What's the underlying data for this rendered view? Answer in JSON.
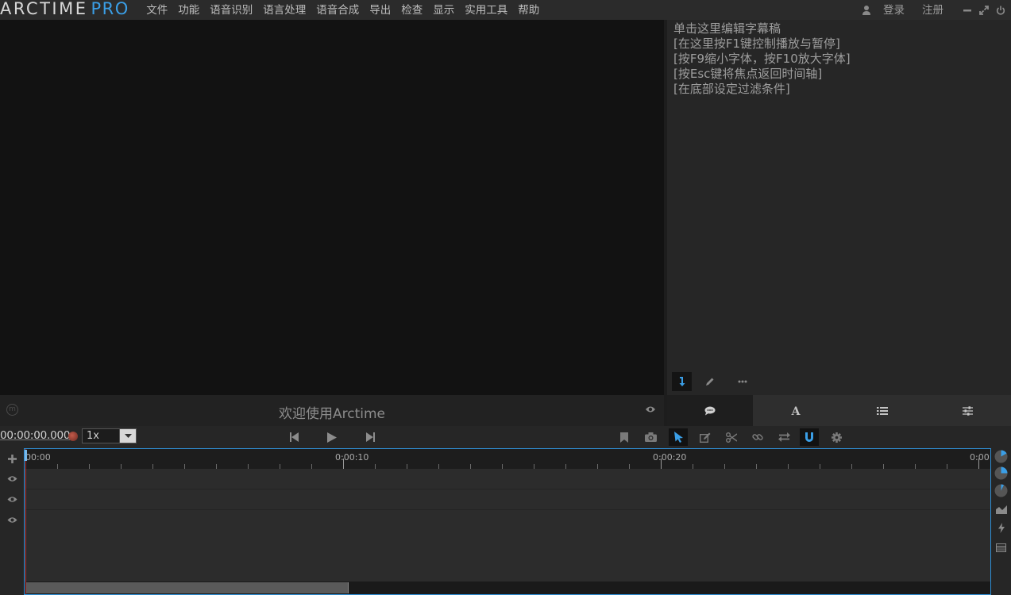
{
  "app": {
    "logo_main": "ARCTIME",
    "logo_pro": "PRO"
  },
  "menu": [
    "文件",
    "功能",
    "语音识别",
    "语言处理",
    "语音合成",
    "导出",
    "检查",
    "显示",
    "实用工具",
    "帮助"
  ],
  "auth": {
    "login": "登录",
    "register": "注册"
  },
  "video": {
    "welcome": "欢迎使用Arctime"
  },
  "script": {
    "lines": [
      "单击这里编辑字幕稿",
      "[在这里按F1键控制播放与暂停]",
      "[按F9缩小字体，按F10放大字体]",
      "[按Esc键将焦点返回时间轴]",
      "[在底部设定过滤条件]"
    ]
  },
  "transport": {
    "timecode": "00:00:00.000",
    "speed": "1x"
  },
  "timeline": {
    "labels": [
      "00:00",
      "0:00:10",
      "0:00:20",
      "0:00:"
    ]
  },
  "colors": {
    "accent": "#3a9ee6",
    "selection_border": "#2f8fd6",
    "playhead": "#b03030"
  },
  "icons": {
    "transport": [
      "skip-back-icon",
      "play-icon",
      "skip-forward-icon"
    ],
    "tools": [
      "bookmark-icon",
      "camera-icon",
      "cursor-icon",
      "edit-icon",
      "scissors-icon",
      "link-icon",
      "swap-icon",
      "magnet-icon",
      "gear-icon"
    ],
    "side_tabs": [
      "chat-icon",
      "font-icon",
      "list-icon",
      "sliders-icon"
    ]
  }
}
